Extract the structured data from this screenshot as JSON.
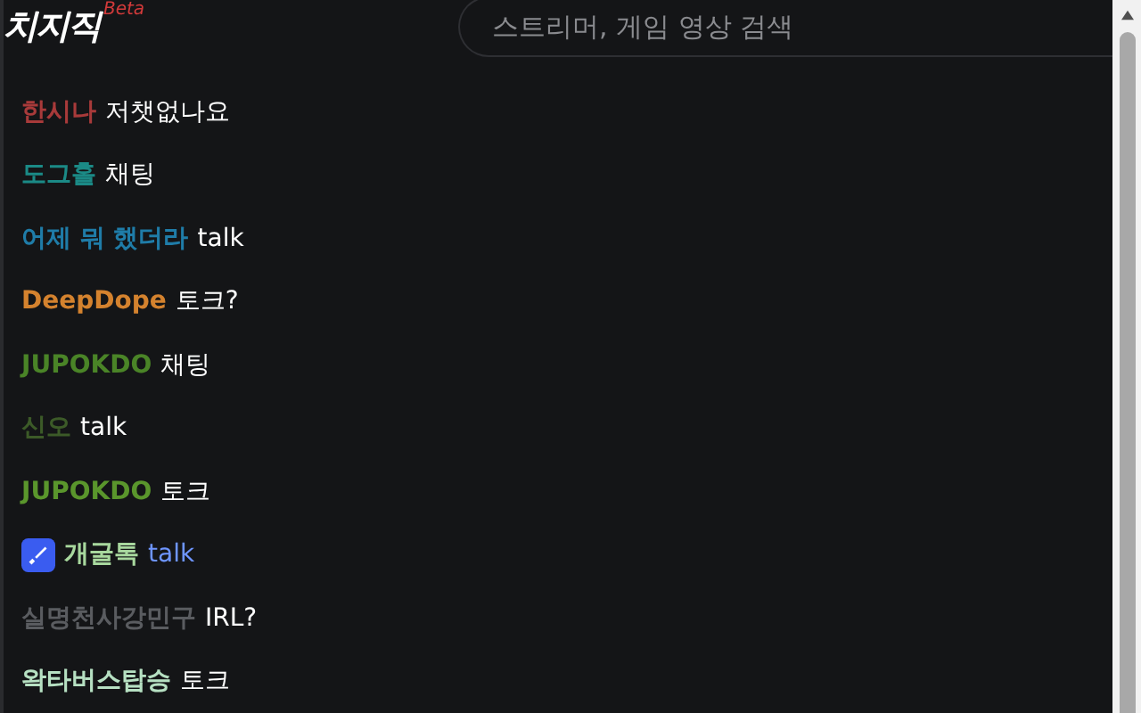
{
  "header": {
    "logo": "치지직",
    "logo_badge": "Beta",
    "search": {
      "placeholder": "스트리머, 게임 영상 검색"
    }
  },
  "chat": [
    {
      "user": {
        "text": "한시나",
        "color": "#a83a3a"
      },
      "message": {
        "text": "저챗없나요",
        "color": "#ffffff"
      },
      "badge": false
    },
    {
      "user": {
        "text": "도그홀",
        "color": "#1b8a86"
      },
      "message": {
        "text": "채팅",
        "color": "#ffffff"
      },
      "badge": false
    },
    {
      "user": {
        "text": "어제 뭐 했더라",
        "color": "#1f7ca8"
      },
      "message": {
        "text": "talk",
        "color": "#ffffff"
      },
      "badge": false
    },
    {
      "user": {
        "text": "DeepDope",
        "color": "#d4822e"
      },
      "message": {
        "text": "토크?",
        "color": "#ffffff"
      },
      "badge": false
    },
    {
      "user": {
        "text": "JUPOKDO",
        "color": "#4a8427"
      },
      "message": {
        "text": "채팅",
        "color": "#ffffff"
      },
      "badge": false
    },
    {
      "user": {
        "text": "신오",
        "color": "#3c5a28"
      },
      "message": {
        "text": "talk",
        "color": "#ffffff"
      },
      "badge": false
    },
    {
      "user": {
        "text": "JUPOKDO",
        "color": "#5a962c"
      },
      "message": {
        "text": "토크",
        "color": "#ffffff"
      },
      "badge": false
    },
    {
      "user": {
        "text": "개굴톡",
        "color": "#a8d89e"
      },
      "message": {
        "text": "talk",
        "color": "#6e95ff"
      },
      "badge": true
    },
    {
      "user": {
        "text": "실명천사강민구",
        "color": "#5a5c60"
      },
      "message": {
        "text": "IRL?",
        "color": "#ffffff"
      },
      "badge": false
    },
    {
      "user": {
        "text": "왁타버스탑승",
        "color": "#b6e0c2"
      },
      "message": {
        "text": "토크",
        "color": "#ffffff"
      },
      "badge": false
    }
  ]
}
